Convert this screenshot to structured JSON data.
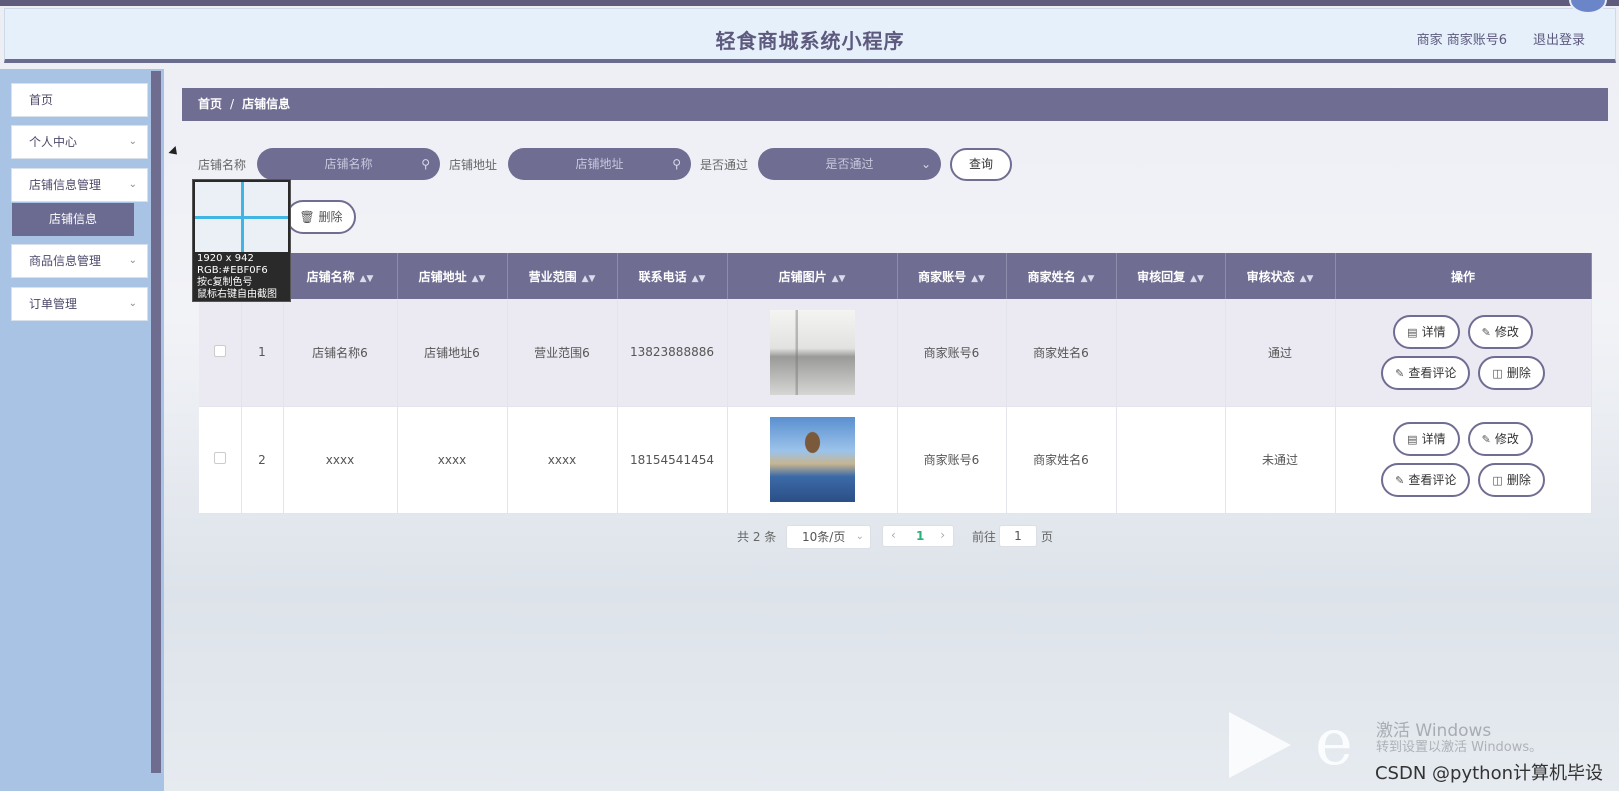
{
  "header": {
    "title": "轻食商城系统小程序",
    "user": "商家 商家账号6",
    "logout": "退出登录"
  },
  "sidebar": {
    "items": [
      {
        "label": "首页",
        "has_chevron": false
      },
      {
        "label": "个人中心",
        "has_chevron": true
      },
      {
        "label": "店铺信息管理",
        "has_chevron": true
      },
      {
        "label": "商品信息管理",
        "has_chevron": true
      },
      {
        "label": "订单管理",
        "has_chevron": true
      }
    ],
    "active_sub": "店铺信息"
  },
  "breadcrumb": {
    "home": "首页",
    "sep": "/",
    "current": "店铺信息"
  },
  "search": {
    "name_label": "店铺名称",
    "name_placeholder": "店铺名称",
    "addr_label": "店铺地址",
    "addr_placeholder": "店铺地址",
    "pass_label": "是否通过",
    "pass_placeholder": "是否通过",
    "query_button": "查询"
  },
  "toolbar": {
    "delete_button": "删除"
  },
  "snap_overlay": {
    "size": "1920 x 942",
    "rgb": "RGB:#EBF0F6",
    "hint1": "按c复制色号",
    "hint2": "鼠标右键自由截图"
  },
  "table": {
    "columns": [
      "",
      "",
      "店铺名称",
      "店铺地址",
      "营业范围",
      "联系电话",
      "店铺图片",
      "商家账号",
      "商家姓名",
      "审核回复",
      "审核状态",
      "操作"
    ],
    "rows": [
      {
        "index": "1",
        "name": "店铺名称6",
        "address": "店铺地址6",
        "scope": "营业范围6",
        "phone": "13823888886",
        "account": "商家账号6",
        "owner": "商家姓名6",
        "reply": "",
        "status": "通过"
      },
      {
        "index": "2",
        "name": "xxxx",
        "address": "xxxx",
        "scope": "xxxx",
        "phone": "18154541454",
        "account": "商家账号6",
        "owner": "商家姓名6",
        "reply": "",
        "status": "未通过"
      }
    ],
    "actions": {
      "detail": "详情",
      "edit": "修改",
      "comments": "查看评论",
      "delete": "删除"
    }
  },
  "pagination": {
    "total": "共 2 条",
    "page_size": "10条/页",
    "current": "1",
    "goto_label": "前往",
    "goto_value": "1",
    "unit": "页"
  },
  "watermark": {
    "line1": "激活 Windows",
    "line2": "转到设置以激活 Windows。",
    "credit": "CSDN @python计算机毕设"
  }
}
